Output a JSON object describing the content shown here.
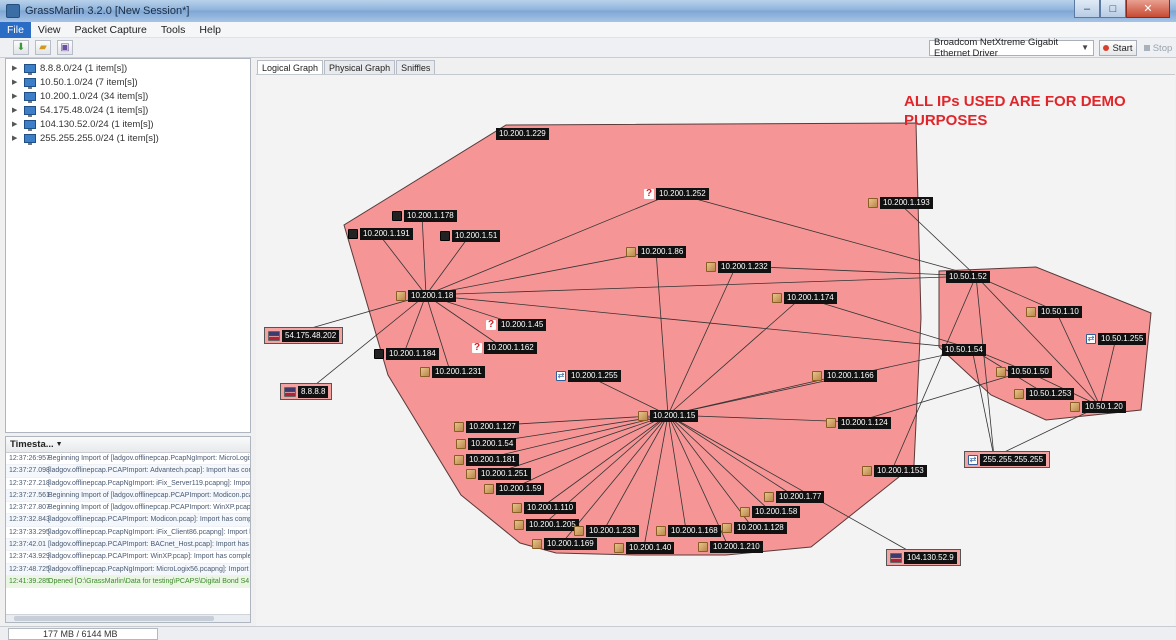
{
  "window": {
    "title": "GrassMarlin 3.2.0 [New Session*]"
  },
  "menu": [
    "File",
    "View",
    "Packet Capture",
    "Tools",
    "Help"
  ],
  "toolbar": {
    "interface": "Broadcom NetXtreme Gigabit Ethernet Driver",
    "start_label": "Start",
    "stop_label": "Stop"
  },
  "tree": [
    "8.8.8.0/24 (1 item[s])",
    "10.50.1.0/24 (7 item[s])",
    "10.200.1.0/24 (34 item[s])",
    "54.175.48.0/24 (1 item[s])",
    "104.130.52.0/24 (1 item[s])",
    "255.255.255.0/24 (1 item[s])"
  ],
  "log": {
    "header": "Timesta...",
    "rows": [
      {
        "ts": "12:37:26:957",
        "msg": "Beginning Import of [ladgov.offlinepcap.PcapNgImport: MicroLogix56..."
      },
      {
        "ts": "12:37:27.098",
        "msg": "[ladgov.offlinepcap.PCAPImport: Advantech.pcap]: Import has complet..."
      },
      {
        "ts": "12:37:27.218",
        "msg": "[ladgov.offlinepcap.PcapNgImport: iFix_Server119.pcapng]: Import has..."
      },
      {
        "ts": "12:37:27.561",
        "msg": "Beginning Import of [ladgov.offlinepcap.PCAPImport: Modicon.pcap]"
      },
      {
        "ts": "12:37:27.807",
        "msg": "Beginning Import of [ladgov.offlinepcap.PCAPImport: WinXP.pcap]"
      },
      {
        "ts": "12:37:32.843",
        "msg": "[ladgov.offlinepcap.PCAPImport: Modicon.pcap]: Import has complete..."
      },
      {
        "ts": "12:37:33.295",
        "msg": "[ladgov.offlinepcap.PcapNgImport: iFix_Client86.pcapng]: Import has c..."
      },
      {
        "ts": "12:37:42.01",
        "msg": "[ladgov.offlinepcap.PCAPImport: BACnet_Host.pcap]: Import has comp..."
      },
      {
        "ts": "12:37:43.929",
        "msg": "[ladgov.offlinepcap.PCAPImport: WinXP.pcap]: Import has completed..."
      },
      {
        "ts": "12:37:48.725",
        "msg": "[ladgov.offlinepcap.PcapNgImport: MicroLogix56.pcapng]: Import has..."
      },
      {
        "ts": "12:41:39.285",
        "msg": "Opened [O:\\GrassMarlin\\Data for testing\\PCAPS\\Digital Bond S4 Conf..."
      }
    ]
  },
  "tabs": [
    "Logical Graph",
    "Physical Graph",
    "Sniffles"
  ],
  "graph": {
    "note": "ALL IPs USED ARE FOR DEMO PURPOSES",
    "nodes": [
      {
        "id": "n229",
        "label": "10.200.1.229",
        "icon": ""
      },
      {
        "id": "n252",
        "label": "10.200.1.252",
        "icon": "unknown"
      },
      {
        "id": "n193",
        "label": "10.200.1.193",
        "icon": "host"
      },
      {
        "id": "n178",
        "label": "10.200.1.178",
        "icon": "plc"
      },
      {
        "id": "n191",
        "label": "10.200.1.191",
        "icon": "plc"
      },
      {
        "id": "n51",
        "label": "10.200.1.51",
        "icon": "plc"
      },
      {
        "id": "n86",
        "label": "10.200.1.86",
        "icon": "host"
      },
      {
        "id": "n232",
        "label": "10.200.1.232",
        "icon": "host"
      },
      {
        "id": "n18",
        "label": "10.200.1.18",
        "icon": "host"
      },
      {
        "id": "n174",
        "label": "10.200.1.174",
        "icon": "host"
      },
      {
        "id": "n45",
        "label": "10.200.1.45",
        "icon": "unknown"
      },
      {
        "id": "n162",
        "label": "10.200.1.162",
        "icon": "unknown"
      },
      {
        "id": "n184",
        "label": "10.200.1.184",
        "icon": "plc"
      },
      {
        "id": "n231",
        "label": "10.200.1.231",
        "icon": "host"
      },
      {
        "id": "n255",
        "label": "10.200.1.255",
        "icon": "router"
      },
      {
        "id": "n166",
        "label": "10.200.1.166",
        "icon": "host"
      },
      {
        "id": "n15",
        "label": "10.200.1.15",
        "icon": "host"
      },
      {
        "id": "n124",
        "label": "10.200.1.124",
        "icon": "host"
      },
      {
        "id": "n127",
        "label": "10.200.1.127",
        "icon": "host"
      },
      {
        "id": "n54",
        "label": "10.200.1.54",
        "icon": "host"
      },
      {
        "id": "n181",
        "label": "10.200.1.181",
        "icon": "host"
      },
      {
        "id": "n251",
        "label": "10.200.1.251",
        "icon": "host"
      },
      {
        "id": "n59",
        "label": "10.200.1.59",
        "icon": "host"
      },
      {
        "id": "n110",
        "label": "10.200.1.110",
        "icon": "host"
      },
      {
        "id": "n205",
        "label": "10.200.1.205",
        "icon": "host"
      },
      {
        "id": "n169",
        "label": "10.200.1.169",
        "icon": "host"
      },
      {
        "id": "n233",
        "label": "10.200.1.233",
        "icon": "host"
      },
      {
        "id": "n40",
        "label": "10.200.1.40",
        "icon": "host"
      },
      {
        "id": "n168",
        "label": "10.200.1.168",
        "icon": "host"
      },
      {
        "id": "n210",
        "label": "10.200.1.210",
        "icon": "host"
      },
      {
        "id": "n128",
        "label": "10.200.1.128",
        "icon": "host"
      },
      {
        "id": "n58",
        "label": "10.200.1.58",
        "icon": "host"
      },
      {
        "id": "n77",
        "label": "10.200.1.77",
        "icon": "host"
      },
      {
        "id": "n153",
        "label": "10.200.1.153",
        "icon": "host"
      },
      {
        "id": "m52",
        "label": "10.50.1.52",
        "icon": ""
      },
      {
        "id": "m10",
        "label": "10.50.1.10",
        "icon": "host"
      },
      {
        "id": "m255",
        "label": "10.50.1.255",
        "icon": "router"
      },
      {
        "id": "m54",
        "label": "10.50.1.54",
        "icon": ""
      },
      {
        "id": "m50",
        "label": "10.50.1.50",
        "icon": "host"
      },
      {
        "id": "m253",
        "label": "10.50.1.253",
        "icon": "host"
      },
      {
        "id": "m20",
        "label": "10.50.1.20",
        "icon": "host"
      },
      {
        "id": "e54",
        "label": "54.175.48.202",
        "icon": "flag"
      },
      {
        "id": "e888",
        "label": "8.8.8.8",
        "icon": "flag"
      },
      {
        "id": "e104",
        "label": "104.130.52.9",
        "icon": "flag"
      },
      {
        "id": "e255",
        "label": "255.255.255.255",
        "icon": "router"
      }
    ]
  },
  "status": {
    "memory": "177 MB / 6144 MB"
  }
}
